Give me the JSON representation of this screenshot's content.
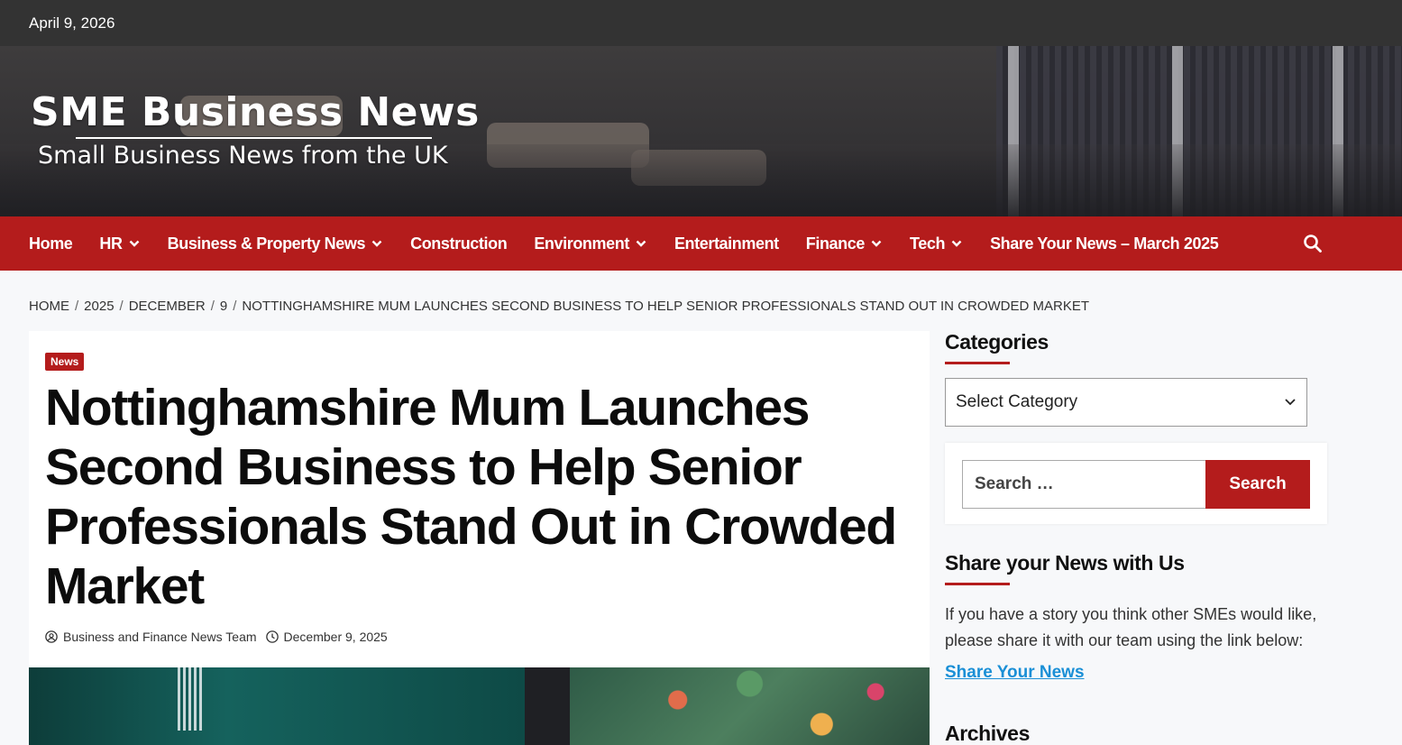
{
  "topbar": {
    "date": "April 9, 2026"
  },
  "site": {
    "title": "SME Business News",
    "tagline": "Small Business News from the UK"
  },
  "nav": {
    "items": [
      {
        "label": "Home",
        "has_dropdown": false
      },
      {
        "label": "HR",
        "has_dropdown": true
      },
      {
        "label": "Business & Property News",
        "has_dropdown": true
      },
      {
        "label": "Construction",
        "has_dropdown": false
      },
      {
        "label": "Environment",
        "has_dropdown": true
      },
      {
        "label": "Entertainment",
        "has_dropdown": false
      },
      {
        "label": "Finance",
        "has_dropdown": true
      },
      {
        "label": "Tech",
        "has_dropdown": true
      },
      {
        "label": "Share Your News – March 2025",
        "has_dropdown": false
      }
    ],
    "search_icon": "search-icon"
  },
  "breadcrumb": [
    "HOME",
    "2025",
    "DECEMBER",
    "9",
    "NOTTINGHAMSHIRE MUM LAUNCHES SECOND BUSINESS TO HELP SENIOR PROFESSIONALS STAND OUT IN CROWDED MARKET"
  ],
  "breadcrumb_separator": "/",
  "article": {
    "category": "News",
    "headline": "Nottinghamshire Mum Launches Second Business to Help Senior Professionals Stand Out in Crowded Market",
    "author": "Business and Finance News Team",
    "date": "December 9, 2025"
  },
  "sidebar": {
    "categories_title": "Categories",
    "select_value": "Select Category",
    "search_placeholder": "Search …",
    "search_button": "Search",
    "share_title": "Share your News with Us",
    "share_text": "If you have a story you think other SMEs would like, please share it with our team using the link below:",
    "share_link": "Share Your News",
    "archives_title": "Archives"
  },
  "colors": {
    "brand_red": "#b41c1c",
    "topbar": "#333333",
    "link_blue": "#1a8fd6"
  }
}
